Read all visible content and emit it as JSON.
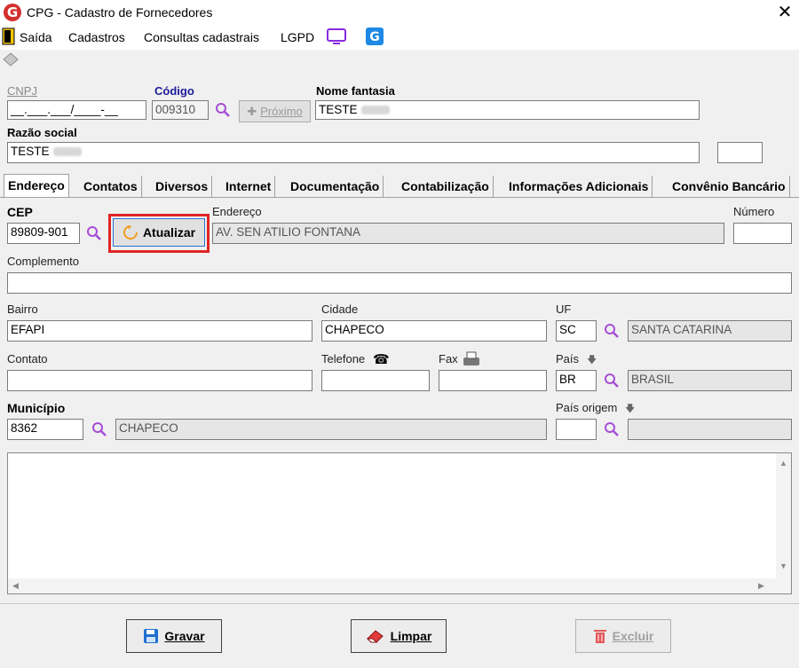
{
  "window": {
    "title": "CPG - Cadastro de Fornecedores",
    "logo": "G"
  },
  "menu": {
    "items": [
      "Saída",
      "Cadastros",
      "Consultas cadastrais",
      "LGPD"
    ]
  },
  "header": {
    "cnpj": {
      "label": "CNPJ",
      "value": "__.___.___/____-__"
    },
    "codigo": {
      "label": "Código",
      "value": "009310"
    },
    "proximo": {
      "label": "Próximo"
    },
    "nome_fantasia": {
      "label": "Nome fantasia",
      "value": "TESTE"
    },
    "razao_social": {
      "label": "Razão social",
      "value": "TESTE"
    }
  },
  "tabs": [
    "Endereço",
    "Contatos",
    "Diversos",
    "Internet",
    "Documentação",
    "Contabilização",
    "Informações Adicionais",
    "Convênio Bancário"
  ],
  "address": {
    "cep": {
      "label": "CEP",
      "value": "89809-901"
    },
    "atualizar": "Atualizar",
    "endereco": {
      "label": "Endereço",
      "value": "AV. SEN ATILIO FONTANA"
    },
    "numero": {
      "label": "Número",
      "value": ""
    },
    "complemento": {
      "label": "Complemento",
      "value": ""
    },
    "bairro": {
      "label": "Bairro",
      "value": "EFAPI"
    },
    "cidade": {
      "label": "Cidade",
      "value": "CHAPECO"
    },
    "uf": {
      "label": "UF",
      "value": "SC",
      "name": "SANTA CATARINA"
    },
    "contato": {
      "label": "Contato",
      "value": ""
    },
    "telefone": {
      "label": "Telefone",
      "value": ""
    },
    "fax": {
      "label": "Fax",
      "value": ""
    },
    "pais": {
      "label": "País",
      "value": "BR",
      "name": "BRASIL"
    },
    "municipio": {
      "label": "Município",
      "value": "8362",
      "name": "CHAPECO"
    },
    "pais_origem": {
      "label": "País origem",
      "value": "",
      "name": ""
    }
  },
  "buttons": {
    "gravar": "Gravar",
    "limpar": "Limpar",
    "excluir": "Excluir"
  },
  "colors": {
    "accent": "#d32f2f",
    "highlight": "#e02424",
    "search": "#a64dd6"
  }
}
